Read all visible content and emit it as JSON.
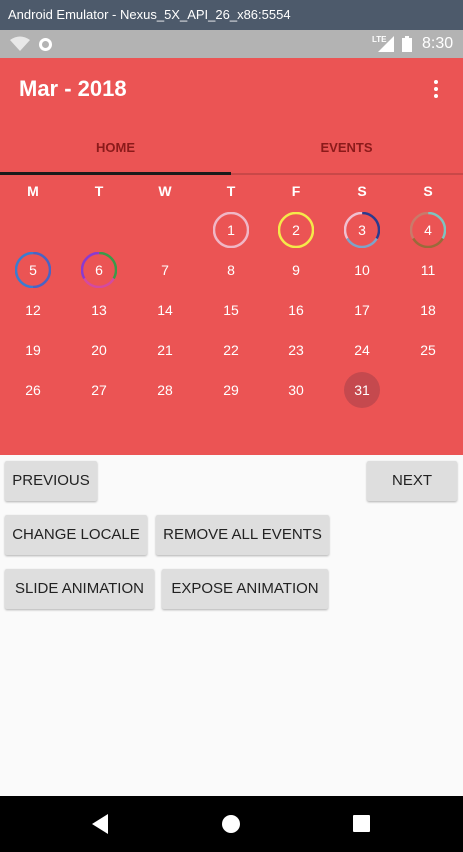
{
  "window": {
    "title": "Android Emulator - Nexus_5X_API_26_x86:5554"
  },
  "status_bar": {
    "network": "LTE",
    "time": "8:30"
  },
  "app_bar": {
    "title": "Mar - 2018"
  },
  "tabs": [
    {
      "label": "HOME",
      "selected": true
    },
    {
      "label": "EVENTS",
      "selected": false
    }
  ],
  "calendar": {
    "weekdays": [
      "M",
      "T",
      "W",
      "T",
      "F",
      "S",
      "S"
    ],
    "weeks": [
      [
        null,
        null,
        null,
        1,
        2,
        3,
        4
      ],
      [
        5,
        6,
        7,
        8,
        9,
        10,
        11
      ],
      [
        12,
        13,
        14,
        15,
        16,
        17,
        18
      ],
      [
        19,
        20,
        21,
        22,
        23,
        24,
        25
      ],
      [
        26,
        27,
        28,
        29,
        30,
        31,
        null
      ]
    ],
    "selected_day": 31,
    "event_days": {
      "1": [
        "#f0b7c6"
      ],
      "2": [
        "#f5e94a"
      ],
      "3": [
        "#2b3a8e",
        "#7ea4c9",
        "#f0c0d0"
      ],
      "4": [
        "#7ec4c0",
        "#9a6a3a",
        "#c97a6a"
      ],
      "5": [
        "#4a63c4",
        "#3a7cd0"
      ],
      "6": [
        "#3a9a4a",
        "#d44aa0",
        "#8a3ad0"
      ]
    }
  },
  "buttons": {
    "previous": "PREVIOUS",
    "next": "NEXT",
    "change_locale": "CHANGE LOCALE",
    "remove_all_events": "REMOVE ALL EVENTS",
    "slide_animation": "SLIDE ANIMATION",
    "expose_animation": "EXPOSE ANIMATION"
  }
}
